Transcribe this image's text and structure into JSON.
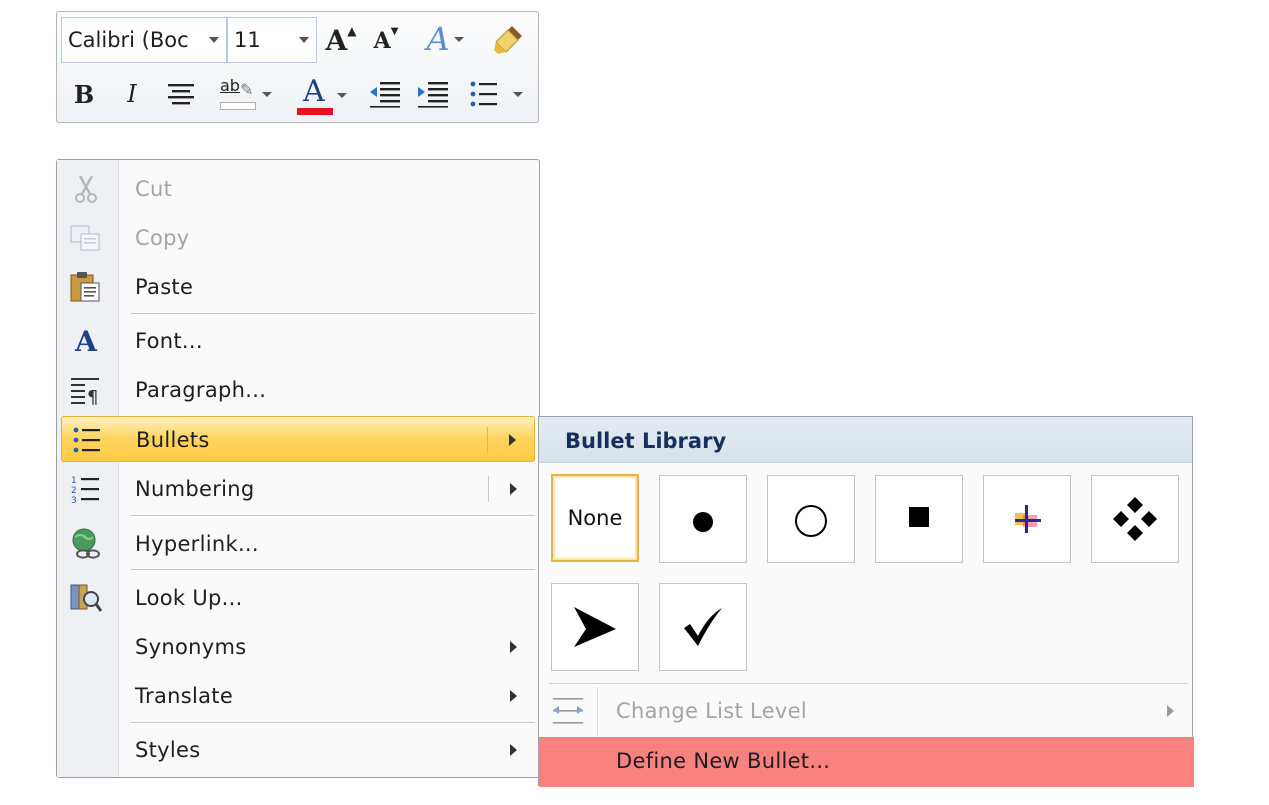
{
  "mini_toolbar": {
    "font_name": "Calibri (Boc",
    "font_size": "11",
    "grow_font": "A",
    "shrink_font": "A",
    "color_letter": "A",
    "bold": "B",
    "italic": "I",
    "highlight_letters": "ab",
    "font_color_letter": "A",
    "font_color_hex": "#e81123",
    "highlight_color_hex": "#ffff00"
  },
  "context_menu": {
    "items": [
      {
        "label": "Cut",
        "icon": "scissors-icon",
        "disabled": true
      },
      {
        "label": "Copy",
        "icon": "copy-icon",
        "disabled": true
      },
      {
        "label": "Paste",
        "icon": "paste-icon"
      },
      {
        "label": "Font...",
        "icon": "font-icon"
      },
      {
        "label": "Paragraph...",
        "icon": "paragraph-icon"
      },
      {
        "label": "Bullets",
        "icon": "bullets-icon",
        "highlighted": true
      },
      {
        "label": "Numbering",
        "icon": "numbering-icon"
      },
      {
        "label": "Hyperlink...",
        "icon": "hyperlink-icon"
      },
      {
        "label": "Look Up...",
        "icon": "research-icon"
      },
      {
        "label": "Synonyms"
      },
      {
        "label": "Translate"
      },
      {
        "label": "Styles"
      }
    ],
    "highlight_color": "#ffd35e"
  },
  "bullet_submenu": {
    "title": "Bullet Library",
    "none_label": "None",
    "bullets": [
      "none",
      "filled-circle",
      "hollow-circle",
      "filled-square",
      "color-cross",
      "four-diamonds",
      "arrowhead",
      "checkmark"
    ],
    "change_list_level": "Change List Level",
    "define_new_bullet": "Define New Bullet...",
    "define_new_bullet_bg": "#f98180"
  }
}
